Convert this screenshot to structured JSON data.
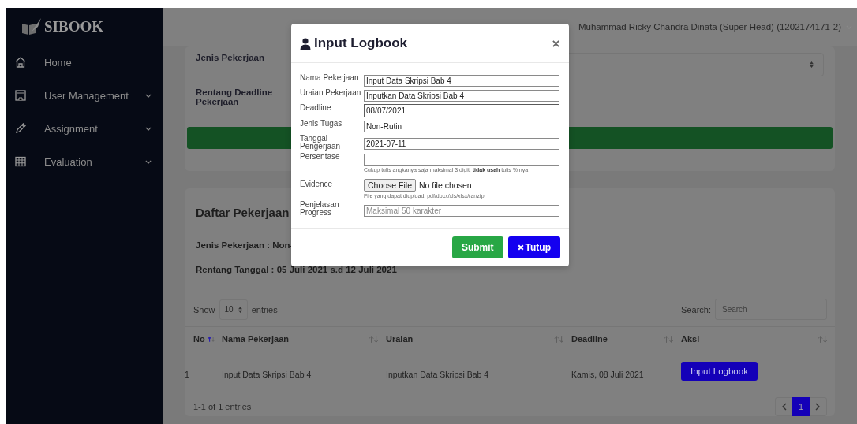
{
  "sidebar": {
    "brand": "SIBOOK",
    "items": [
      {
        "label": "Home",
        "expandable": false
      },
      {
        "label": "User Management",
        "expandable": true
      },
      {
        "label": "Assignment",
        "expandable": true
      },
      {
        "label": "Evaluation",
        "expandable": true
      }
    ]
  },
  "topbar": {
    "user": "Muhammad Ricky Chandra Dinata (Super Head) (1202174171-2)"
  },
  "filter": {
    "fields": [
      {
        "label": "Jenis Pekerjaan",
        "kind": "select"
      },
      {
        "label": "Rentang Deadline Pekerjaan",
        "kind": "range"
      }
    ]
  },
  "list_card": {
    "title": "Daftar Pekerjaan",
    "info": [
      "Jenis Pekerjaan : Non-",
      "Rentang Tanggal : 05 Juli 2021 s.d 12 Juli 2021"
    ],
    "show_label": "Show",
    "page_size": "10",
    "entries_label": "entries",
    "search_label": "Search:",
    "search_placeholder": "Search",
    "table": {
      "columns": [
        {
          "label": "No",
          "sort_active": true
        },
        {
          "label": "Nama Pekerjaan",
          "sort_active": false
        },
        {
          "label": "Uraian",
          "sort_active": false
        },
        {
          "label": "Deadline",
          "sort_active": false
        },
        {
          "label": "Aksi",
          "sort_active": false
        }
      ],
      "rows": [
        {
          "no": "1",
          "name": "Input Data Skripsi Bab 4",
          "desc": "Inputkan Data Skripsi Bab 4",
          "deadline": "Kamis, 08 Juli 2021",
          "action": "Input Logbook"
        }
      ]
    },
    "summary": "1-1 of 1 entries",
    "pages": [
      {
        "label": "1",
        "selected": true
      }
    ]
  },
  "modal": {
    "title": "Input Logbook",
    "fields": [
      {
        "label": "Nama Pekerjaan",
        "kind": "text",
        "value": "Input Data Skripsi Bab 4"
      },
      {
        "label": "Uraian Pekerjaan",
        "kind": "text",
        "value": "Inputkan Data Skripsi Bab 4"
      },
      {
        "label": "Deadline",
        "kind": "date",
        "value": "08/07/2021"
      },
      {
        "label": "Jenis Tugas",
        "kind": "text",
        "value": "Non-Rutin"
      },
      {
        "label": "Tanggal Pengerjaan",
        "kind": "text",
        "value": "2021-07-11"
      },
      {
        "label": "Persentase",
        "kind": "text",
        "hint": "Cukup tulis angkanya saja maksimal 3 digit, **tidak usah** tulis % nya"
      },
      {
        "label": "Evidence",
        "kind": "file",
        "button": "Choose File",
        "status": "No file chosen",
        "hint": "File yang dapat diupload: pdf/docx/xls/xlsx/rar/zip"
      },
      {
        "label": "Penjelasan Progress",
        "kind": "text",
        "placeholder": "Maksimal 50 karakter"
      }
    ],
    "buttons": [
      {
        "label": "Submit",
        "kind": "submit"
      },
      {
        "label": "Tutup",
        "kind": "close"
      }
    ]
  }
}
